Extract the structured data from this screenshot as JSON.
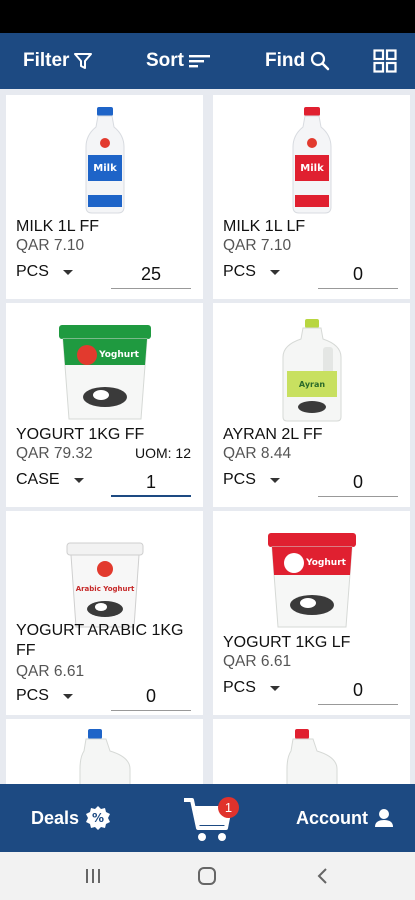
{
  "toolbar": {
    "filter_label": "Filter",
    "sort_label": "Sort",
    "find_label": "Find",
    "filter_icon": "filter-icon",
    "sort_icon": "sort-icon",
    "find_icon": "search-icon",
    "grid_icon": "grid-view-icon"
  },
  "products": [
    {
      "name": "MILK 1L FF",
      "price": "QAR 7.10",
      "uom": "",
      "unit": "PCS",
      "qty": "25",
      "cap_color": "#1e64c8"
    },
    {
      "name": "MILK 1L LF",
      "price": "QAR 7.10",
      "uom": "",
      "unit": "PCS",
      "qty": "0",
      "cap_color": "#e02030"
    },
    {
      "name": "YOGURT 1KG FF",
      "price": "QAR 79.32",
      "uom": "UOM: 12",
      "unit": "CASE",
      "qty": "1",
      "cap_color": "#1f9a40"
    },
    {
      "name": "AYRAN 2L FF",
      "price": "QAR 8.44",
      "uom": "",
      "unit": "PCS",
      "qty": "0",
      "cap_color": "#b8d640"
    },
    {
      "name": "YOGURT ARABIC 1KG FF",
      "price": "QAR 6.61",
      "uom": "",
      "unit": "PCS",
      "qty": "0",
      "cap_color": "#ffffff"
    },
    {
      "name": "YOGURT 1KG LF",
      "price": "QAR 6.61",
      "uom": "",
      "unit": "PCS",
      "qty": "0",
      "cap_color": "#e02030"
    }
  ],
  "bottom": {
    "deals_label": "Deals",
    "cart_badge": "1",
    "account_label": "Account"
  },
  "colors": {
    "primary": "#1d4a82",
    "badge": "#e0322c"
  }
}
